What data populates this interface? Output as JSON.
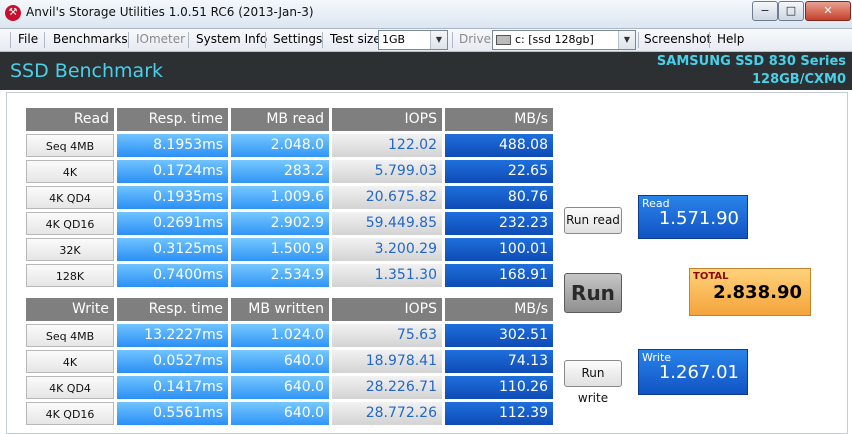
{
  "window": {
    "title": "Anvil's Storage Utilities 1.0.51 RC6 (2013-Jan-3)"
  },
  "menu": {
    "file": "File",
    "benchmarks": "Benchmarks",
    "iometer": "IOmeter",
    "system_info": "System Info",
    "settings": "Settings",
    "test_size_label": "Test size",
    "test_size_value": "1GB",
    "drive_label": "Drive",
    "drive_value": "c: [ssd 128gb]",
    "screenshot": "Screenshot",
    "help": "Help"
  },
  "header": {
    "title": "SSD Benchmark",
    "model": "SAMSUNG SSD 830 Series",
    "firmware": "128GB/CXM0"
  },
  "read_table": {
    "headers": [
      "Read",
      "Resp. time",
      "MB read",
      "IOPS",
      "MB/s"
    ],
    "rows": [
      [
        "Seq 4MB",
        "8.1953ms",
        "2.048.0",
        "122.02",
        "488.08"
      ],
      [
        "4K",
        "0.1724ms",
        "283.2",
        "5.799.03",
        "22.65"
      ],
      [
        "4K QD4",
        "0.1935ms",
        "1.009.6",
        "20.675.82",
        "80.76"
      ],
      [
        "4K QD16",
        "0.2691ms",
        "2.902.9",
        "59.449.85",
        "232.23"
      ],
      [
        "32K",
        "0.3125ms",
        "1.500.9",
        "3.200.29",
        "100.01"
      ],
      [
        "128K",
        "0.7400ms",
        "2.534.9",
        "1.351.30",
        "168.91"
      ]
    ]
  },
  "write_table": {
    "headers": [
      "Write",
      "Resp. time",
      "MB written",
      "IOPS",
      "MB/s"
    ],
    "rows": [
      [
        "Seq 4MB",
        "13.2227ms",
        "1.024.0",
        "75.63",
        "302.51"
      ],
      [
        "4K",
        "0.0527ms",
        "640.0",
        "18.978.41",
        "74.13"
      ],
      [
        "4K QD4",
        "0.1417ms",
        "640.0",
        "28.226.71",
        "110.26"
      ],
      [
        "4K QD16",
        "0.5561ms",
        "640.0",
        "28.772.26",
        "112.39"
      ]
    ]
  },
  "buttons": {
    "run_read": "Run read",
    "run": "Run",
    "run_write": "Run write"
  },
  "scores": {
    "read_caption": "Read",
    "read_value": "1.571.90",
    "total_caption": "TOTAL",
    "total_value": "2.838.90",
    "write_caption": "Write",
    "write_value": "1.267.01"
  }
}
